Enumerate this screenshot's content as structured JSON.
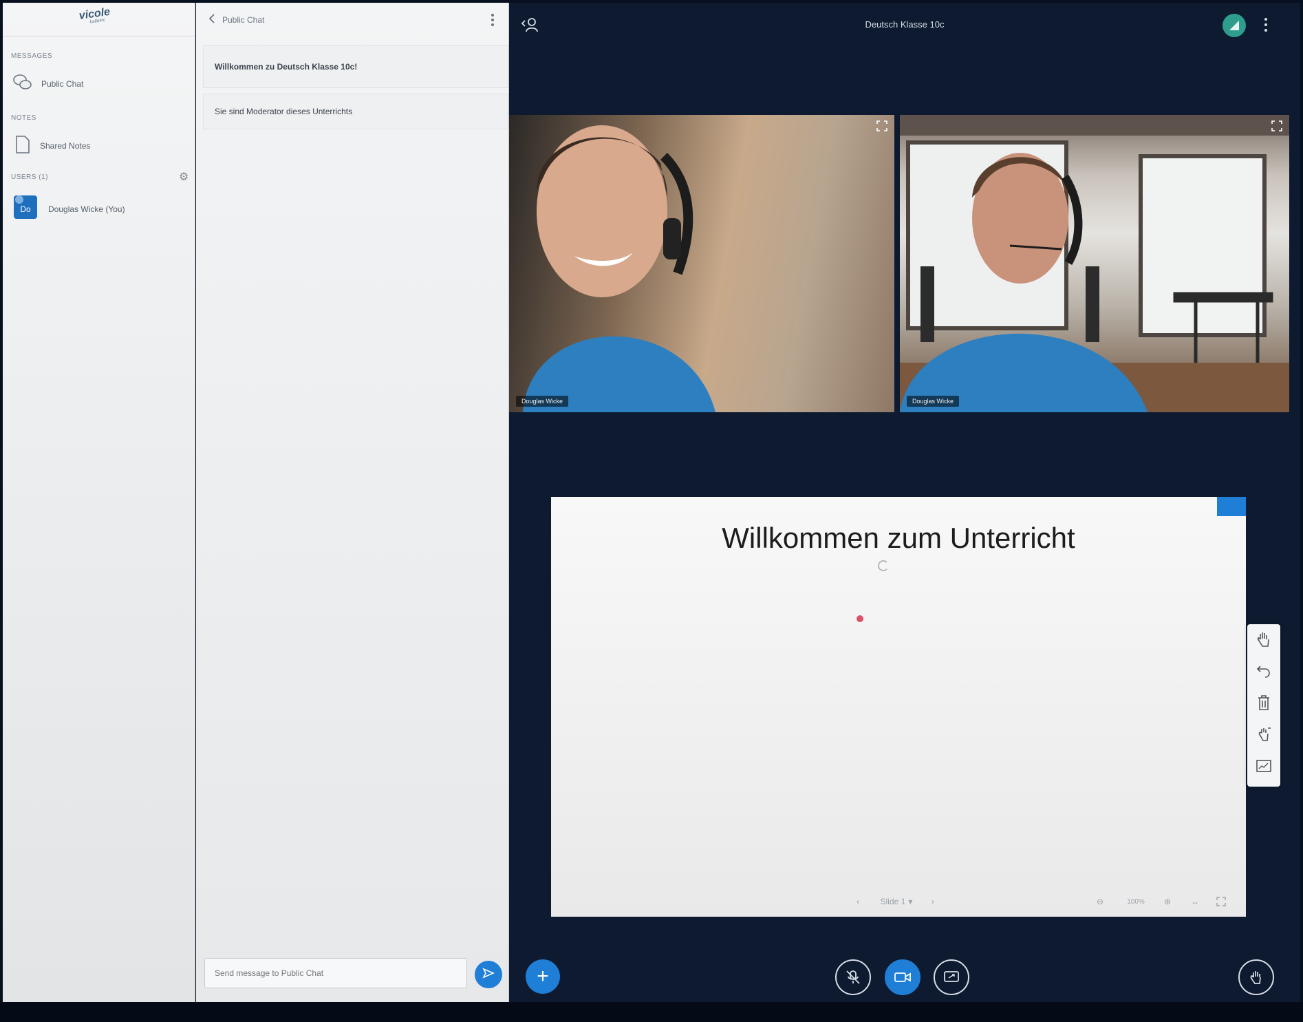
{
  "userlist": {
    "logo_text": "vicole",
    "logo_sub": "kalleinc",
    "sections": {
      "messages_label": "MESSAGES",
      "notes_label": "NOTES",
      "users_label": "USERS (1)"
    },
    "public_chat_label": "Public Chat",
    "shared_notes_label": "Shared Notes",
    "current_user_label": "Douglas Wicke (You)"
  },
  "chat": {
    "title": "Public Chat",
    "messages": [
      "Willkommen zu Deutsch Klasse 10c!",
      "Sie sind Moderator dieses Unterrichts"
    ],
    "input_placeholder": "Send message to Public Chat"
  },
  "main": {
    "meeting_title": "Deutsch Klasse 10c",
    "videos": [
      {
        "name": "Douglas Wicke"
      },
      {
        "name": "Douglas Wicke"
      }
    ],
    "presentation": {
      "slide_title": "Willkommen zum Unterricht",
      "slide_selector": "Slide 1",
      "zoom": "100%"
    }
  },
  "colors": {
    "accent": "#1f7ed6",
    "main_bg": "#0d1a30",
    "connection": "#2f9d8d"
  },
  "icons": {
    "users_toggle": "users-icon",
    "expand": "expand-icon",
    "hand": "hand-tool-icon",
    "undo": "undo-icon",
    "trash": "trash-icon",
    "pointer": "multi-user-icon",
    "whiteboard": "whiteboard-icon",
    "mute": "microphone-off-icon",
    "camera": "camera-icon",
    "share": "screen-share-icon",
    "raise_hand": "raise-hand-icon"
  }
}
